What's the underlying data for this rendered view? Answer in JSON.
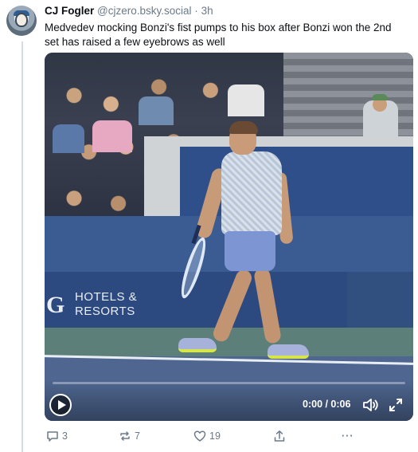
{
  "post": {
    "author": "CJ Fogler",
    "handle": "@cjzero.bsky.social",
    "separator": "·",
    "time": "3h",
    "text": "Medvedev mocking Bonzi's fist pumps to his box after Bonzi won the 2nd set has raised a few eyebrows as well"
  },
  "media": {
    "sign_letter": "G",
    "sign_line1": "HOTELS &",
    "sign_line2": "RESORTS",
    "video_time": "0:00 / 0:06"
  },
  "actions": {
    "replies": "3",
    "reposts": "7",
    "likes": "19",
    "more": "···"
  }
}
